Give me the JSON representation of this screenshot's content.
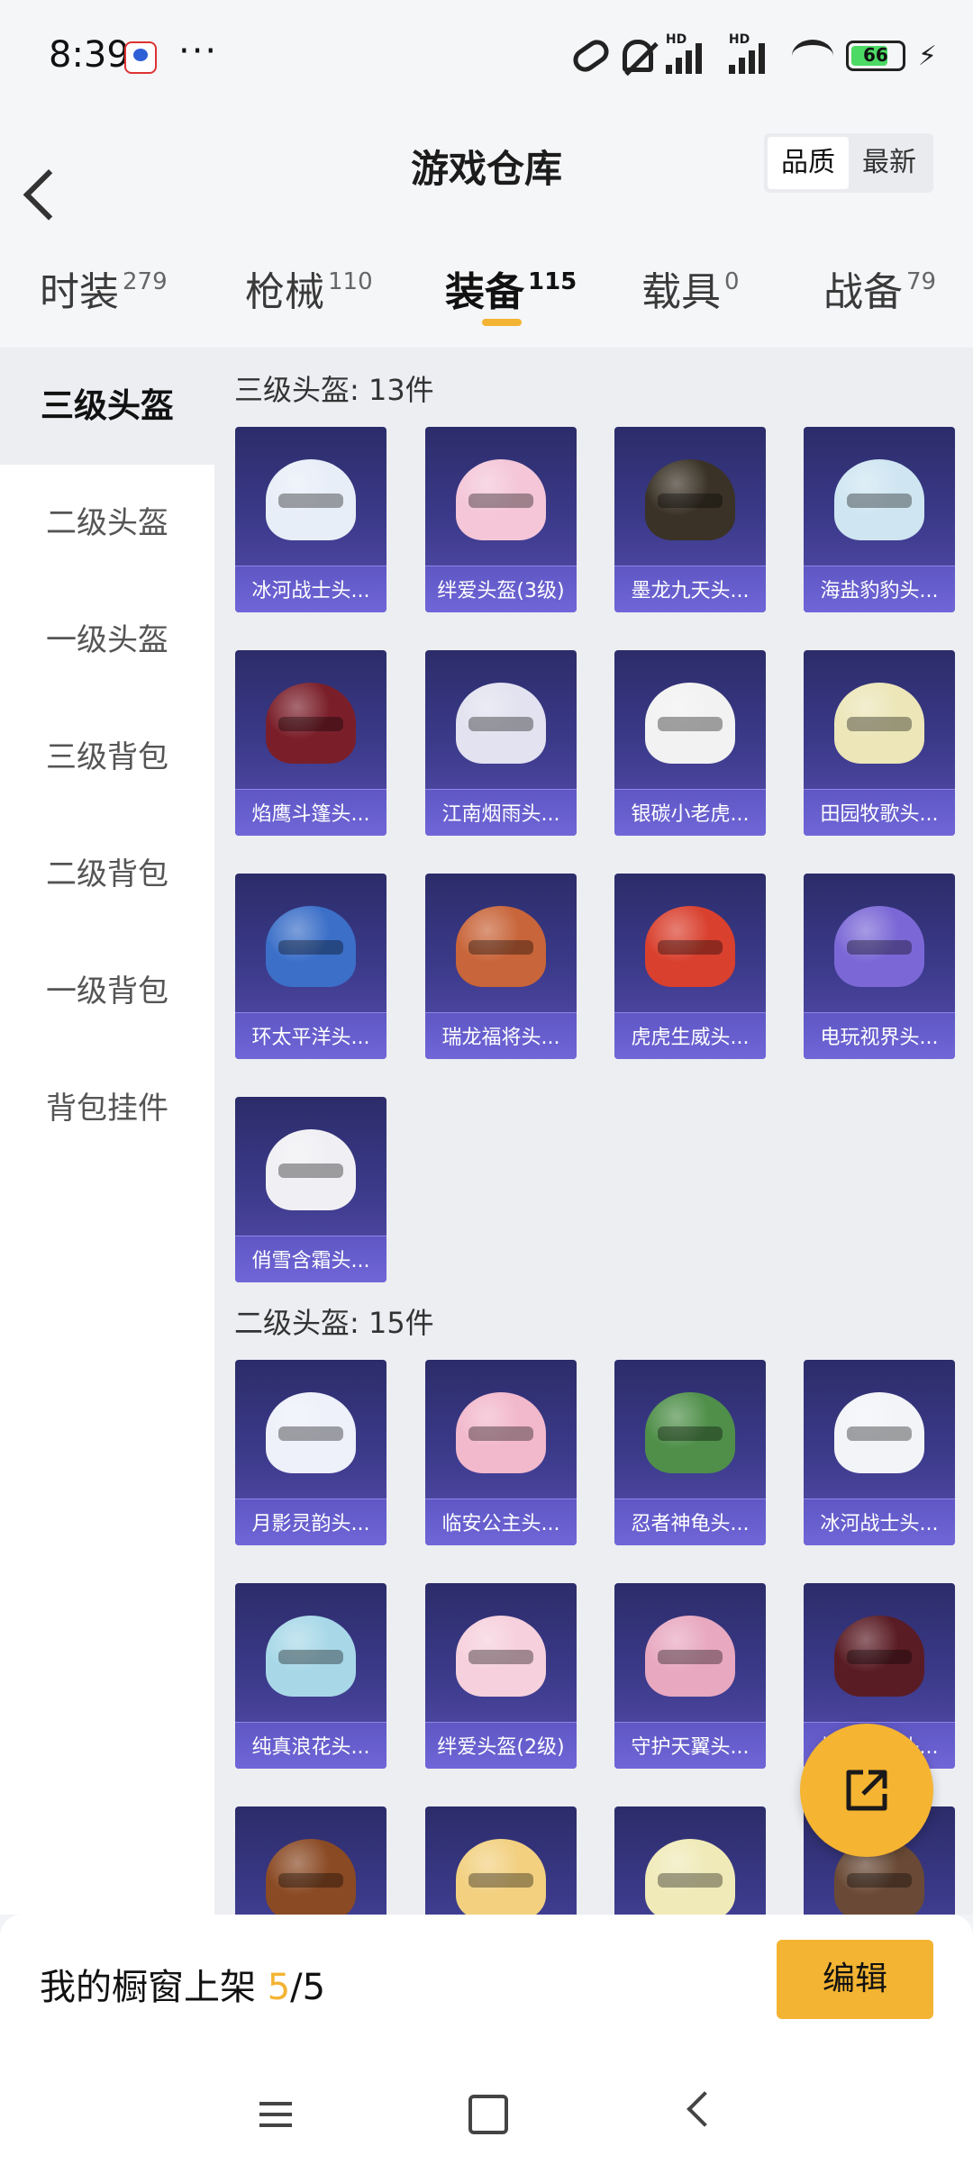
{
  "status_bar": {
    "time": "8:39",
    "more_indicator": "···",
    "battery_level": "66",
    "icons": [
      "link-icon",
      "mute-bell-icon",
      "signal-hd-icon",
      "signal-hd-icon",
      "wifi-icon",
      "battery-icon",
      "charging-bolt-icon"
    ]
  },
  "header": {
    "back_icon": "chevron-left-icon",
    "title": "游戏仓库",
    "sort_options": [
      "品质",
      "最新"
    ],
    "active_sort": "品质"
  },
  "tabs": [
    {
      "label": "时装",
      "count": "279"
    },
    {
      "label": "枪械",
      "count": "110"
    },
    {
      "label": "装备",
      "count": "115"
    },
    {
      "label": "载具",
      "count": "0"
    },
    {
      "label": "战备",
      "count": "79"
    }
  ],
  "active_tab": "装备",
  "sidebar": {
    "items": [
      "三级头盔",
      "二级头盔",
      "一级头盔",
      "三级背包",
      "二级背包",
      "一级背包",
      "背包挂件"
    ],
    "active": "三级头盔"
  },
  "sections": [
    {
      "title": "三级头盔: 13件",
      "items": [
        {
          "name": "冰河战士头...",
          "color": "#e8eef8"
        },
        {
          "name": "绊爱头盔(3级)",
          "color": "#f4c6d8"
        },
        {
          "name": "墨龙九天头...",
          "color": "#3a3226"
        },
        {
          "name": "海盐豹豹头...",
          "color": "#cfe6f2"
        },
        {
          "name": "焰鹰斗篷头...",
          "color": "#7a1f2a"
        },
        {
          "name": "江南烟雨头...",
          "color": "#e2e2f0"
        },
        {
          "name": "银碳小老虎...",
          "color": "#f2f2f2"
        },
        {
          "name": "田园牧歌头...",
          "color": "#ece6b8"
        },
        {
          "name": "环太平洋头...",
          "color": "#3b6fc8"
        },
        {
          "name": "瑞龙福将头...",
          "color": "#c8653a"
        },
        {
          "name": "虎虎生威头...",
          "color": "#d9402e"
        },
        {
          "name": "电玩视界头...",
          "color": "#7b68d6"
        },
        {
          "name": "俏雪含霜头...",
          "color": "#f0f0f4"
        }
      ]
    },
    {
      "title": "二级头盔: 15件",
      "items": [
        {
          "name": "月影灵韵头...",
          "color": "#eef0fa"
        },
        {
          "name": "临安公主头...",
          "color": "#f2b8cc"
        },
        {
          "name": "忍者神龟头...",
          "color": "#4f8f4a"
        },
        {
          "name": "冰河战士头...",
          "color": "#f2f4f8"
        },
        {
          "name": "纯真浪花头...",
          "color": "#a8d8e8"
        },
        {
          "name": "绊爱头盔(2级)",
          "color": "#f6d0dc"
        },
        {
          "name": "守护天翼头...",
          "color": "#e8a8c0"
        },
        {
          "name": "焰鹰斗篷头...",
          "color": "#5a1c24"
        },
        {
          "name": "",
          "color": "#8a4a24"
        },
        {
          "name": "",
          "color": "#f2d080"
        },
        {
          "name": "",
          "color": "#f0eab8"
        },
        {
          "name": "",
          "color": "#6a4a36"
        }
      ]
    }
  ],
  "fab": {
    "icon": "share-external-icon"
  },
  "bottom": {
    "shelf_label": "我的橱窗上架",
    "shelf_used": "5",
    "shelf_total": "/5",
    "edit_label": "编辑"
  },
  "nav": {
    "icons": [
      "menu-icon",
      "home-square-icon",
      "back-triangle-icon"
    ]
  }
}
